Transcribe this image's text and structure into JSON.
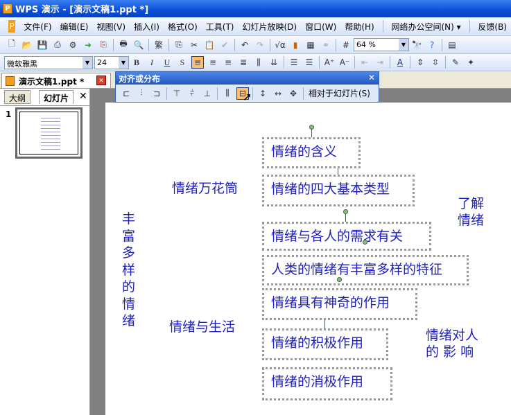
{
  "window": {
    "title": "WPS 演示 - [演示文稿1.ppt *]",
    "app_icon": "P"
  },
  "menu": [
    "文件(F)",
    "编辑(E)",
    "视图(V)",
    "插入(I)",
    "格式(O)",
    "工具(T)",
    "幻灯片放映(D)",
    "窗口(W)",
    "帮助(H)",
    "网络办公空间(N) ▾",
    "反馈(B)"
  ],
  "toolbar": {
    "zoom": "64 %",
    "font": "微软雅黑",
    "size": "24",
    "bold": "B",
    "italic": "I",
    "underline": "U",
    "shadow": "S",
    "trad": "繁"
  },
  "tab": {
    "doc": "演示文稿1.ppt *"
  },
  "panel": {
    "tab_outline": "大纲",
    "tab_slides": "幻灯片",
    "close": "✕",
    "slide_num": "1"
  },
  "dialog": {
    "title": "对齐或分布",
    "close": "✕",
    "relative": "相对于幻灯片(S)"
  },
  "slide": {
    "boxes": [
      "情绪的含义",
      "情绪的四大基本类型",
      "情绪与各人的需求有关",
      "人类的情绪有丰富多样的特征",
      "情绪具有神奇的作用",
      "情绪的积极作用",
      "情绪的消极作用"
    ],
    "label_kaleidoscope": "情绪万花筒",
    "label_understand": [
      "了解",
      "情绪"
    ],
    "label_vertical": [
      "丰",
      "富",
      "多",
      "样",
      "的",
      "情",
      "绪"
    ],
    "label_life": "情绪与生活",
    "label_effect": [
      "情绪对人",
      "的 影 响"
    ]
  },
  "colors": {
    "text": "#2020c0",
    "titlebar": "#0a4fd8"
  }
}
